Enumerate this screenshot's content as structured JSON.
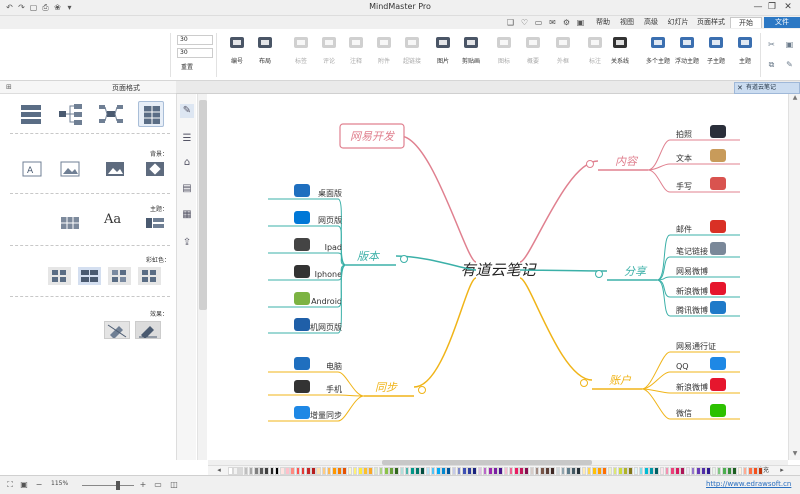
{
  "window": {
    "title": "MindMaster Pro",
    "minimize": "—",
    "maximize": "❐",
    "close": "✕"
  },
  "quick_access": [
    "↶",
    "↷",
    "▢",
    "⎙",
    "❀",
    "▾"
  ],
  "menu": {
    "file": "文件",
    "tabs": [
      "开始",
      "页面样式",
      "幻灯片",
      "高级",
      "视图",
      "帮助"
    ],
    "active": "开始",
    "right_icons": [
      "▣",
      "⚙",
      "✉",
      "▭",
      "♡",
      "❑"
    ]
  },
  "ribbon": {
    "groups": [
      {
        "label": "主题",
        "state": "on",
        "color": "#3b6fb0"
      },
      {
        "label": "子主题",
        "state": "on",
        "color": "#3b6fb0"
      },
      {
        "label": "浮动主题",
        "state": "on",
        "color": "#3b6fb0"
      },
      {
        "label": "多个主题",
        "state": "on",
        "color": "#3b6fb0"
      },
      {
        "label": "关系线",
        "state": "on",
        "color": "#333333"
      },
      {
        "label": "标注",
        "state": "dis",
        "color": "#7a7a7a"
      },
      {
        "label": "外框",
        "state": "dis",
        "color": "#7a7a7a"
      },
      {
        "label": "概要",
        "state": "dis",
        "color": "#7a7a7a"
      },
      {
        "label": "图标",
        "state": "dis",
        "color": "#7a7a7a"
      },
      {
        "label": "剪贴画",
        "state": "on",
        "color": "#4a5566"
      },
      {
        "label": "图片",
        "state": "on",
        "color": "#4a5566"
      },
      {
        "label": "超链接",
        "state": "dis",
        "color": "#7a7a7a"
      },
      {
        "label": "附件",
        "state": "dis",
        "color": "#7a7a7a"
      },
      {
        "label": "注释",
        "state": "dis",
        "color": "#7a7a7a"
      },
      {
        "label": "评论",
        "state": "dis",
        "color": "#7a7a7a"
      },
      {
        "label": "标签",
        "state": "dis",
        "color": "#7a7a7a"
      },
      {
        "label": "布局",
        "state": "on",
        "color": "#4a5566"
      },
      {
        "label": "编号",
        "state": "on",
        "color": "#4a5566"
      }
    ],
    "spin_values": [
      "30",
      "30"
    ],
    "reset_label": "重置",
    "left_small": [
      "▣",
      "✂",
      "⧉",
      "✎"
    ]
  },
  "doc_tab": {
    "label": "有道云笔记",
    "close": "✕"
  },
  "panel": {
    "title": "页面格式",
    "sections": {
      "background": "背景：",
      "theme": "主题：",
      "fill": "彩虹色：",
      "effects": "效果："
    },
    "theme_font_sample": "Aa"
  },
  "mindmap": {
    "center": "有道云笔记",
    "branches": [
      {
        "topic": "内容",
        "color": "#e0808f",
        "side": "right",
        "children": [
          {
            "text": "拍照",
            "icon": "camera-icon"
          },
          {
            "text": "文本",
            "icon": "book-icon"
          },
          {
            "text": "手写",
            "icon": "pen-cup-icon"
          }
        ]
      },
      {
        "topic": "分享",
        "color": "#3bb0a8",
        "side": "right",
        "children": [
          {
            "text": "邮件",
            "icon": "gmail-icon"
          },
          {
            "text": "笔记链接",
            "icon": "link-icon"
          },
          {
            "text": "网易微博",
            "icon": ""
          },
          {
            "text": "新浪微博",
            "icon": "weibo-icon"
          },
          {
            "text": "腾讯微博",
            "icon": "tencent-weibo-icon"
          }
        ]
      },
      {
        "topic": "账户",
        "color": "#f0b418",
        "side": "right",
        "children": [
          {
            "text": "网易通行证",
            "icon": ""
          },
          {
            "text": "QQ",
            "icon": "qq-icon"
          },
          {
            "text": "新浪微博",
            "icon": "weibo-icon"
          },
          {
            "text": "微信",
            "icon": "wechat-icon"
          }
        ]
      },
      {
        "topic": "网易开发",
        "color": "#e0808f",
        "side": "left",
        "boxed": true,
        "children": []
      },
      {
        "topic": "版本",
        "color": "#3bb0a8",
        "side": "left",
        "children": [
          {
            "text": "桌面版",
            "icon": "desktop-icon"
          },
          {
            "text": "网页版",
            "icon": "windows-icon"
          },
          {
            "text": "Ipad",
            "icon": "apple-icon"
          },
          {
            "text": "Iphone",
            "icon": "iphone-icon"
          },
          {
            "text": "Android",
            "icon": "android-icon"
          },
          {
            "text": "手机网页版",
            "icon": "paw-icon"
          }
        ]
      },
      {
        "topic": "同步",
        "color": "#f0b418",
        "side": "left",
        "children": [
          {
            "text": "电脑",
            "icon": "monitor-icon"
          },
          {
            "text": "手机",
            "icon": "phone-icon"
          },
          {
            "text": "增量同步",
            "icon": "cloud-icon"
          }
        ]
      }
    ]
  },
  "palette": {
    "label": "填充",
    "colors": [
      "#ffffff",
      "#f2f2f2",
      "#d9d9d9",
      "#bfbfbf",
      "#a6a6a6",
      "#808080",
      "#595959",
      "#404040",
      "#262626",
      "#000000",
      "#ffe4e1",
      "#ffc0cb",
      "#ff8a80",
      "#ff5252",
      "#e53935",
      "#c62828",
      "#b71c1c",
      "#ffe0b2",
      "#ffcc80",
      "#ffb74d",
      "#ff9800",
      "#f57c00",
      "#e65100",
      "#fff9c4",
      "#fff176",
      "#ffeb3b",
      "#fbc02d",
      "#f9a825",
      "#dcedc8",
      "#aed581",
      "#8bc34a",
      "#689f38",
      "#33691e",
      "#b2dfdb",
      "#4db6ac",
      "#009688",
      "#00796b",
      "#004d40",
      "#b3e5fc",
      "#4fc3f7",
      "#03a9f4",
      "#0288d1",
      "#01579b",
      "#c5cae9",
      "#7986cb",
      "#3f51b5",
      "#303f9f",
      "#1a237e",
      "#e1bee7",
      "#ba68c8",
      "#9c27b0",
      "#7b1fa2",
      "#4a148c",
      "#f8bbd0",
      "#f06292",
      "#e91e63",
      "#c2185b",
      "#880e4f",
      "#d7ccc8",
      "#a1887f",
      "#795548",
      "#5d4037",
      "#3e2723",
      "#cfd8dc",
      "#90a4ae",
      "#607d8b",
      "#455a64",
      "#263238",
      "#ffecb3",
      "#ffd54f",
      "#ffc107",
      "#ffa000",
      "#ff6f00",
      "#f0f4c3",
      "#dce775",
      "#cddc39",
      "#afb42b",
      "#827717",
      "#e0f7fa",
      "#80deea",
      "#00bcd4",
      "#0097a7",
      "#006064",
      "#fce4ec",
      "#f48fb1",
      "#ec407a",
      "#d81b60",
      "#ad1457",
      "#ede7f6",
      "#9575cd",
      "#673ab7",
      "#512da8",
      "#311b92",
      "#e8f5e9",
      "#81c784",
      "#4caf50",
      "#388e3c",
      "#1b5e20",
      "#fff3e0",
      "#ffab91",
      "#ff7043",
      "#f4511e",
      "#bf360c"
    ]
  },
  "status": {
    "url": "http://www.edrawsoft.cn",
    "zoom": "115%",
    "zoom_in": "+",
    "zoom_out": "−"
  },
  "colors": {
    "accent": "#2c78c4",
    "center_text": "#222222"
  }
}
